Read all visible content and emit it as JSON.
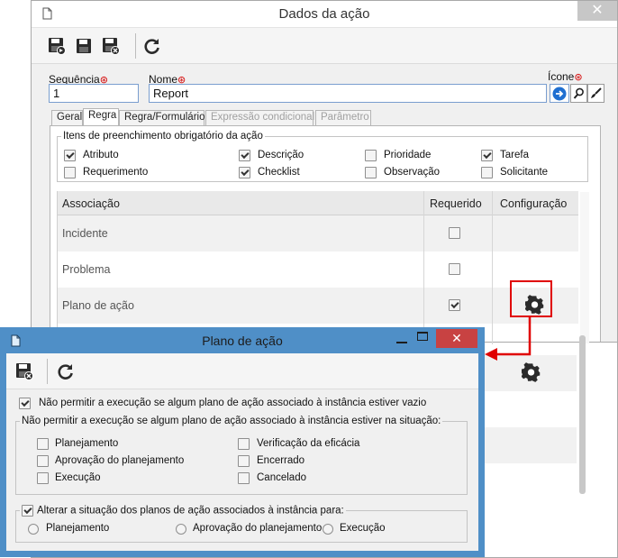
{
  "main_window": {
    "title": "Dados da ação",
    "fields": {
      "sequence_label": "Sequência",
      "sequence_value": "1",
      "name_label": "Nome",
      "name_value": "Report",
      "icon_label": "Ícone"
    },
    "tabs": [
      {
        "label": "Geral",
        "state": "normal"
      },
      {
        "label": "Regra",
        "state": "active"
      },
      {
        "label": "Regra/Formulário",
        "state": "normal"
      },
      {
        "label": "Expressão condicional",
        "state": "disabled"
      },
      {
        "label": "Parâmetro",
        "state": "disabled"
      }
    ],
    "required_group": {
      "legend": "Itens de preenchimento obrigatório da ação",
      "items": [
        {
          "label": "Atributo",
          "checked": true
        },
        {
          "label": "Descrição",
          "checked": true
        },
        {
          "label": "Prioridade",
          "checked": false
        },
        {
          "label": "Tarefa",
          "checked": true
        },
        {
          "label": "Requerimento",
          "checked": false
        },
        {
          "label": "Checklist",
          "checked": true
        },
        {
          "label": "Observação",
          "checked": false
        },
        {
          "label": "Solicitante",
          "checked": false
        }
      ]
    },
    "grid": {
      "columns": [
        "Associação",
        "Requerido",
        "Configuração"
      ],
      "rows": [
        {
          "name": "Incidente",
          "required": false
        },
        {
          "name": "Problema",
          "required": false
        },
        {
          "name": "Plano de ação",
          "required": true
        }
      ]
    }
  },
  "popup": {
    "title": "Plano de ação",
    "block_if_empty": {
      "label": "Não permitir a execução se algum plano de ação associado à instância estiver vazio",
      "checked": true
    },
    "block_situation_group": {
      "legend": "Não permitir a execução se algum plano de ação associado à instância estiver na situação:",
      "items": [
        {
          "label": "Planejamento",
          "checked": false
        },
        {
          "label": "Verificação da eficácia",
          "checked": false
        },
        {
          "label": "Aprovação do planejamento",
          "checked": false
        },
        {
          "label": "Encerrado",
          "checked": false
        },
        {
          "label": "Execução",
          "checked": false
        },
        {
          "label": "Cancelado",
          "checked": false
        }
      ]
    },
    "change_situation_group": {
      "legend": "Alterar a situação dos planos de ação associados à instância para:",
      "checked": true,
      "options": [
        "Planejamento",
        "Aprovação do planejamento",
        "Execução"
      ]
    }
  },
  "colors": {
    "highlight": "#e00000",
    "popup_frame": "#4f8fc7",
    "popup_close": "#c84242"
  }
}
